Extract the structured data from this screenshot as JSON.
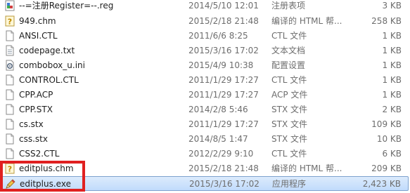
{
  "files": [
    {
      "name": "--=注册Register=--.reg",
      "date": "2014/5/10 12:01",
      "type": "注册表项",
      "size": "3 KB",
      "icon": "registry-icon"
    },
    {
      "name": "949.chm",
      "date": "2015/2/18 21:48",
      "type": "编译的 HTML 帮...",
      "size": "258 KB",
      "icon": "chm-help-icon"
    },
    {
      "name": "ANSI.CTL",
      "date": "2011/6/6 8:25",
      "type": "CTL 文件",
      "size": "1 KB",
      "icon": "generic-file-icon"
    },
    {
      "name": "codepage.txt",
      "date": "2015/3/16 17:02",
      "type": "文本文档",
      "size": "1 KB",
      "icon": "text-file-icon"
    },
    {
      "name": "combobox_u.ini",
      "date": "2015/4/9 10:38",
      "type": "配置设置",
      "size": "1 KB",
      "icon": "settings-file-icon"
    },
    {
      "name": "CONTROL.CTL",
      "date": "2011/1/29 17:27",
      "type": "CTL 文件",
      "size": "1 KB",
      "icon": "generic-file-icon"
    },
    {
      "name": "CPP.ACP",
      "date": "2011/1/29 17:27",
      "type": "ACP 文件",
      "size": "1 KB",
      "icon": "generic-file-icon"
    },
    {
      "name": "CPP.STX",
      "date": "2014/2/8 5:46",
      "type": "STX 文件",
      "size": "2 KB",
      "icon": "generic-file-icon"
    },
    {
      "name": "cs.stx",
      "date": "2011/1/29 17:27",
      "type": "STX 文件",
      "size": "109 KB",
      "icon": "generic-file-icon"
    },
    {
      "name": "css.stx",
      "date": "2014/8/5 1:47",
      "type": "STX 文件",
      "size": "10 KB",
      "icon": "generic-file-icon"
    },
    {
      "name": "CSS2.CTL",
      "date": "2012/2/29 9:10",
      "type": "CTL 文件",
      "size": "6 KB",
      "icon": "generic-file-icon"
    },
    {
      "name": "editplus.chm",
      "date": "2015/2/18 21:48",
      "type": "编译的 HTML 帮...",
      "size": "209 KB",
      "icon": "chm-help-icon"
    },
    {
      "name": "editplus.exe",
      "date": "2015/3/16 17:02",
      "type": "应用程序",
      "size": "2,423 KB",
      "icon": "editplus-app-icon",
      "selected": true
    }
  ]
}
